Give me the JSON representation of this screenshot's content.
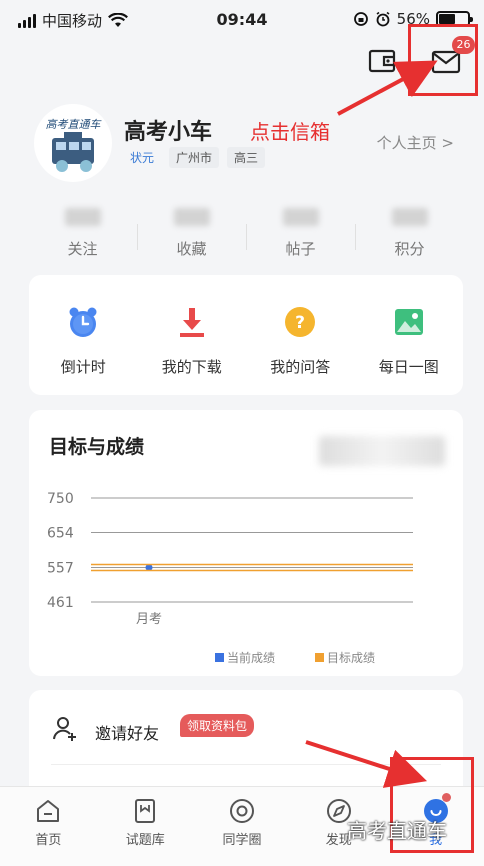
{
  "status_bar": {
    "carrier": "中国移动",
    "time": "09:44",
    "battery_percent": "56%",
    "battery_level": 0.56
  },
  "header": {
    "mail_badge": "26",
    "annotation_text": "点击信箱"
  },
  "profile": {
    "name": "高考小车",
    "avatar_text": "高考直通车",
    "tags": [
      "状元",
      "广州市",
      "高三"
    ],
    "homepage_link": "个人主页 >"
  },
  "stats": [
    {
      "label": "关注"
    },
    {
      "label": "收藏"
    },
    {
      "label": "帖子"
    },
    {
      "label": "积分"
    }
  ],
  "tools": [
    {
      "label": "倒计时",
      "icon": "alarm-clock-icon"
    },
    {
      "label": "我的下载",
      "icon": "download-icon"
    },
    {
      "label": "我的问答",
      "icon": "question-icon"
    },
    {
      "label": "每日一图",
      "icon": "image-icon"
    }
  ],
  "goal_card": {
    "title": "目标与成绩"
  },
  "chart_data": {
    "type": "line",
    "categories": [
      "月考"
    ],
    "series": [
      {
        "name": "当前成绩",
        "values": [
          557
        ],
        "color": "#3a72e0"
      },
      {
        "name": "目标成绩",
        "values": [
          557
        ],
        "color": "#f0a030"
      }
    ],
    "y_ticks": [
      461,
      557,
      654,
      750
    ],
    "ylim": [
      461,
      750
    ],
    "grid": true,
    "legend": "bottom-right"
  },
  "invite": {
    "label": "邀请好友",
    "badge": "领取资料包"
  },
  "tabbar": {
    "items": [
      {
        "label": "首页",
        "icon": "home-icon"
      },
      {
        "label": "试题库",
        "icon": "question-bank-icon"
      },
      {
        "label": "同学圈",
        "icon": "circle-icon"
      },
      {
        "label": "发现",
        "icon": "compass-icon"
      },
      {
        "label": "我",
        "icon": "me-icon",
        "active": true
      }
    ],
    "watermark": "高考直通车"
  },
  "colors": {
    "accent": "#2f72e3",
    "annotation": "#e63030",
    "badge": "#e34a4a"
  }
}
